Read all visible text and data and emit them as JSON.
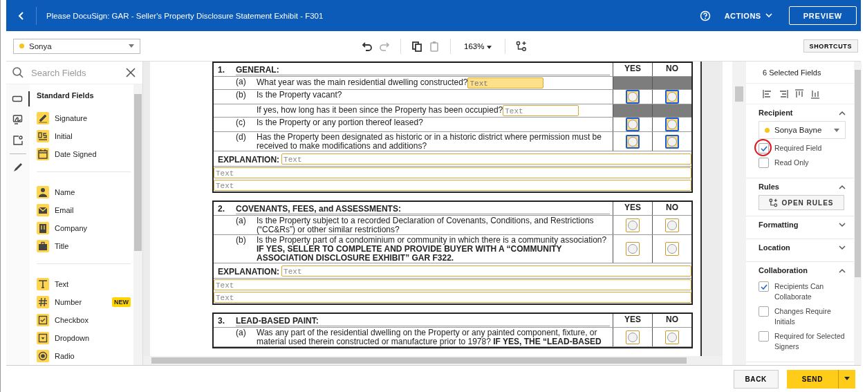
{
  "top_bar": {
    "title": "Please DocuSign: GAR - Seller's Property Disclosure Statement Exhibit - F301",
    "actions_label": "ACTIONS",
    "preview_label": "PREVIEW"
  },
  "toolbar": {
    "recipient": {
      "name": "Sonya",
      "color": "#f5c518"
    },
    "tools": [
      {
        "kind": "undo",
        "disabled": false
      },
      {
        "kind": "redo",
        "disabled": true
      },
      {
        "kind": "copy",
        "disabled": false
      },
      {
        "kind": "paste",
        "disabled": true
      }
    ],
    "zoom": "163%",
    "shortcuts_label": "SHORTCUTS"
  },
  "field_panel": {
    "search_placeholder": "Search Fields",
    "rail": [
      {
        "kind": "field",
        "selected": true
      },
      {
        "kind": "signature",
        "selected": false
      },
      {
        "kind": "contact",
        "selected": false
      },
      {
        "kind": "draw",
        "selected": false
      }
    ],
    "heading": "Standard Fields",
    "groups": [
      {
        "items": [
          {
            "kind": "signature",
            "label": "Signature"
          },
          {
            "kind": "initial",
            "label": "Initial"
          },
          {
            "kind": "date",
            "label": "Date Signed"
          }
        ]
      },
      {
        "items": [
          {
            "kind": "name",
            "label": "Name"
          },
          {
            "kind": "email",
            "label": "Email"
          },
          {
            "kind": "company",
            "label": "Company"
          },
          {
            "kind": "title",
            "label": "Title"
          }
        ]
      },
      {
        "items": [
          {
            "kind": "text",
            "label": "Text"
          },
          {
            "kind": "number",
            "label": "Number",
            "badge": "NEW"
          },
          {
            "kind": "checkbox",
            "label": "Checkbox"
          },
          {
            "kind": "dropdown",
            "label": "Dropdown"
          },
          {
            "kind": "radio",
            "label": "Radio"
          }
        ]
      }
    ]
  },
  "document": {
    "sections": [
      {
        "number": "1.",
        "title": "GENERAL:",
        "yes_label": "YES",
        "no_label": "NO",
        "questions": [
          {
            "letter": "(a)",
            "text": "What year was the main residential dwelling constructed?",
            "field": {
              "placeholder": "Text",
              "filled": true
            },
            "kind": "shaded"
          },
          {
            "letter": "(b)",
            "text": "Is the Property vacant?",
            "kind": "radio",
            "radios": [
              {
                "selected": true
              },
              {
                "selected": true
              }
            ]
          },
          {
            "text": "If yes, how long has it been since the Property has been occupied?",
            "field": {
              "placeholder": "Text",
              "filled": false
            },
            "kind": "shaded"
          },
          {
            "letter": "(c)",
            "text": "Is the Property or any portion thereof leased?",
            "kind": "radio",
            "radios": [
              {
                "selected": true
              },
              {
                "selected": true
              }
            ]
          },
          {
            "letter": "(d)",
            "text": "Has the Property been designated as historic or in a historic district where permission must be received to make modifications and additions?",
            "kind": "radio",
            "radios": [
              {
                "selected": true
              },
              {
                "selected": true
              }
            ]
          }
        ],
        "explanation": {
          "label": "EXPLANATION:",
          "fields": [
            "Text",
            "Text",
            "Text"
          ]
        }
      },
      {
        "number": "2.",
        "title": "COVENANTS, FEES, and ASSESSMENTS:",
        "yes_label": "YES",
        "no_label": "NO",
        "questions": [
          {
            "letter": "(a)",
            "text": "Is the Property subject to a recorded Declaration of Covenants, Conditions, and Restrictions (“CC&Rs”) or other similar restrictions?",
            "kind": "radio",
            "radios": [
              {
                "selected": false
              },
              {
                "selected": false
              }
            ]
          },
          {
            "letter": "(b)",
            "text": "Is the Property part of a condominium or community in which there is a community association? **IF YES, SELLER TO COMPLETE AND PROVIDE BUYER WITH A “COMMUNITY ASSOCIATION DISCLOSURE EXHIBIT” GAR F322.**",
            "kind": "radio",
            "radios": [
              {
                "selected": false
              },
              {
                "selected": false
              }
            ]
          }
        ],
        "explanation": {
          "label": "EXPLANATION:",
          "fields": [
            "Text",
            "Text",
            "Text"
          ]
        }
      },
      {
        "number": "3.",
        "title": "LEAD-BASED PAINT:",
        "yes_label": "YES",
        "no_label": "NO",
        "questions": [
          {
            "letter": "(a)",
            "text": "Was any part of the residential dwelling on the Property or any painted component, fixture, or material used therein constructed or manufacture prior to 1978?  **IF YES, THE “LEAD-BASED**",
            "kind": "radio",
            "radios": [
              {
                "selected": false
              },
              {
                "selected": false
              }
            ]
          }
        ]
      }
    ]
  },
  "properties": {
    "heading": "6 Selected Fields",
    "sections": [
      {
        "kind": "recipient",
        "title": "Recipient",
        "expanded": true,
        "recipient": {
          "name": "Sonya Bayne",
          "color": "#f5c518"
        },
        "options": [
          {
            "label": "Required Field",
            "checked": true,
            "circled": true
          },
          {
            "label": "Read Only",
            "checked": false,
            "circled": false
          }
        ]
      },
      {
        "kind": "rules",
        "title": "Rules",
        "expanded": true,
        "button": "OPEN RULES"
      },
      {
        "title": "Formatting",
        "expanded": false
      },
      {
        "title": "Location",
        "expanded": false
      },
      {
        "kind": "options",
        "title": "Collaboration",
        "expanded": true,
        "options": [
          {
            "label": "Recipients Can Collaborate",
            "checked": true,
            "circled": false
          },
          {
            "label": "Changes Require Initials",
            "checked": false,
            "circled": false
          },
          {
            "label": "Required for Selected Signers",
            "checked": false,
            "circled": false
          }
        ]
      }
    ]
  },
  "footer": {
    "back_label": "BACK",
    "send_label": "SEND"
  }
}
